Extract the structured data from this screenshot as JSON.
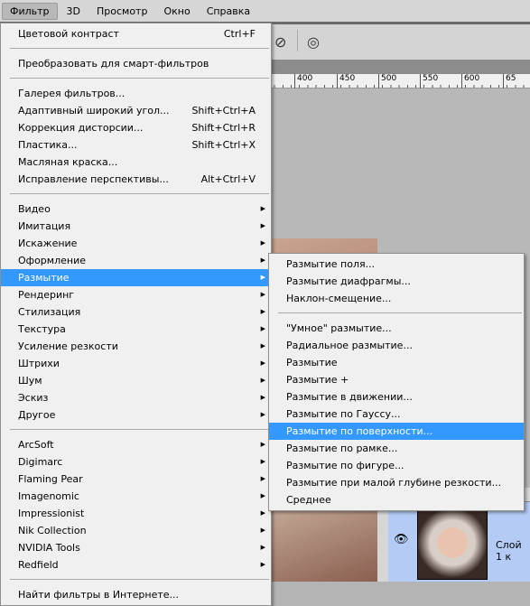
{
  "menubar": [
    "Фильтр",
    "3D",
    "Просмотр",
    "Окно",
    "Справка"
  ],
  "ruler_ticks": [
    "400",
    "450",
    "500",
    "550",
    "600",
    "65"
  ],
  "filter_menu": [
    {
      "label": "Цветовой контраст",
      "shortcut": "Ctrl+F"
    },
    {
      "sep": true
    },
    {
      "label": "Преобразовать для смарт-фильтров"
    },
    {
      "sep": true
    },
    {
      "label": "Галерея фильтров..."
    },
    {
      "label": "Адаптивный широкий угол...",
      "shortcut": "Shift+Ctrl+A"
    },
    {
      "label": "Коррекция дисторсии...",
      "shortcut": "Shift+Ctrl+R"
    },
    {
      "label": "Пластика...",
      "shortcut": "Shift+Ctrl+X"
    },
    {
      "label": "Масляная краска..."
    },
    {
      "label": "Исправление перспективы...",
      "shortcut": "Alt+Ctrl+V"
    },
    {
      "sep": true
    },
    {
      "label": "Видео",
      "submenu": true
    },
    {
      "label": "Имитация",
      "submenu": true
    },
    {
      "label": "Искажение",
      "submenu": true
    },
    {
      "label": "Оформление",
      "submenu": true
    },
    {
      "label": "Размытие",
      "submenu": true,
      "highlighted": true
    },
    {
      "label": "Рендеринг",
      "submenu": true
    },
    {
      "label": "Стилизация",
      "submenu": true
    },
    {
      "label": "Текстура",
      "submenu": true
    },
    {
      "label": "Усиление резкости",
      "submenu": true
    },
    {
      "label": "Штрихи",
      "submenu": true
    },
    {
      "label": "Шум",
      "submenu": true
    },
    {
      "label": "Эскиз",
      "submenu": true
    },
    {
      "label": "Другое",
      "submenu": true
    },
    {
      "sep": true
    },
    {
      "label": "ArcSoft",
      "submenu": true
    },
    {
      "label": "Digimarc",
      "submenu": true
    },
    {
      "label": "Flaming Pear",
      "submenu": true
    },
    {
      "label": "Imagenomic",
      "submenu": true
    },
    {
      "label": "Impressionist",
      "submenu": true
    },
    {
      "label": "Nik Collection",
      "submenu": true
    },
    {
      "label": "NVIDIA Tools",
      "submenu": true
    },
    {
      "label": "Redfield",
      "submenu": true
    },
    {
      "sep": true
    },
    {
      "label": "Найти фильтры в Интернете..."
    }
  ],
  "blur_submenu": [
    {
      "label": "Размытие поля..."
    },
    {
      "label": "Размытие диафрагмы..."
    },
    {
      "label": "Наклон-смещение..."
    },
    {
      "sep": true
    },
    {
      "label": "\"Умное\" размытие..."
    },
    {
      "label": "Радиальное размытие..."
    },
    {
      "label": "Размытие"
    },
    {
      "label": "Размытие +"
    },
    {
      "label": "Размытие в движении..."
    },
    {
      "label": "Размытие по Гауссу..."
    },
    {
      "label": "Размытие по поверхности...",
      "highlighted": true
    },
    {
      "label": "Размытие по рамке..."
    },
    {
      "label": "Размытие по фигуре..."
    },
    {
      "label": "Размытие при малой глубине резкости..."
    },
    {
      "label": "Среднее"
    }
  ],
  "layers": {
    "layer_name": "Слой 1 к"
  },
  "colors": {
    "highlight": "#3399ff",
    "menu_bg": "#f0f0f0",
    "layer_selected": "#b4cbf5"
  }
}
